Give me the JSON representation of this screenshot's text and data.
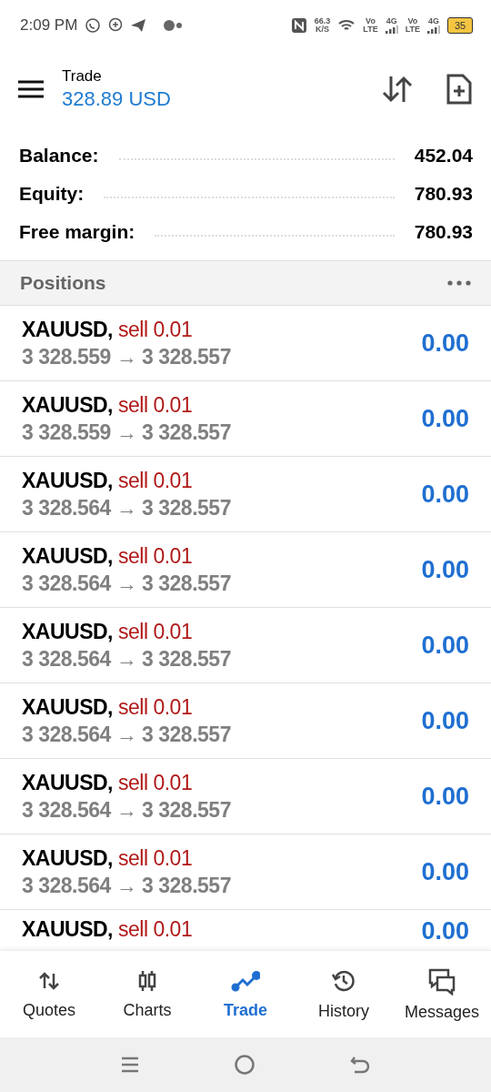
{
  "status_bar": {
    "time": "2:09 PM",
    "speed": "66.3",
    "speed_unit": "K/S",
    "sims": [
      {
        "volte": "Vo",
        "lte": "LTE",
        "network": "4G"
      },
      {
        "volte": "Vo",
        "lte": "LTE",
        "network": "4G"
      }
    ],
    "battery": "35"
  },
  "header": {
    "title": "Trade",
    "subtitle": "328.89 USD"
  },
  "summary": [
    {
      "label": "Balance:",
      "value": "452.04"
    },
    {
      "label": "Equity:",
      "value": "780.93"
    },
    {
      "label": "Free margin:",
      "value": "780.93"
    }
  ],
  "positions": {
    "title": "Positions",
    "rows": [
      {
        "symbol": "XAUUSD,",
        "side": "sell 0.01",
        "prices": "3 328.559 → 3 328.557",
        "profit": "0.00"
      },
      {
        "symbol": "XAUUSD,",
        "side": "sell 0.01",
        "prices": "3 328.559 → 3 328.557",
        "profit": "0.00"
      },
      {
        "symbol": "XAUUSD,",
        "side": "sell 0.01",
        "prices": "3 328.564 → 3 328.557",
        "profit": "0.00"
      },
      {
        "symbol": "XAUUSD,",
        "side": "sell 0.01",
        "prices": "3 328.564 → 3 328.557",
        "profit": "0.00"
      },
      {
        "symbol": "XAUUSD,",
        "side": "sell 0.01",
        "prices": "3 328.564 → 3 328.557",
        "profit": "0.00"
      },
      {
        "symbol": "XAUUSD,",
        "side": "sell 0.01",
        "prices": "3 328.564 → 3 328.557",
        "profit": "0.00"
      },
      {
        "symbol": "XAUUSD,",
        "side": "sell 0.01",
        "prices": "3 328.564 → 3 328.557",
        "profit": "0.00"
      },
      {
        "symbol": "XAUUSD,",
        "side": "sell 0.01",
        "prices": "3 328.564 → 3 328.557",
        "profit": "0.00"
      },
      {
        "symbol": "XAUUSD,",
        "side": "sell 0.01",
        "profit": "0.00"
      }
    ]
  },
  "tabs": [
    {
      "label": "Quotes",
      "kind": "quotes",
      "selected": false
    },
    {
      "label": "Charts",
      "kind": "charts",
      "selected": false
    },
    {
      "label": "Trade",
      "kind": "trade",
      "selected": true
    },
    {
      "label": "History",
      "kind": "history",
      "selected": false
    },
    {
      "label": "Messages",
      "kind": "messages",
      "selected": false
    }
  ]
}
